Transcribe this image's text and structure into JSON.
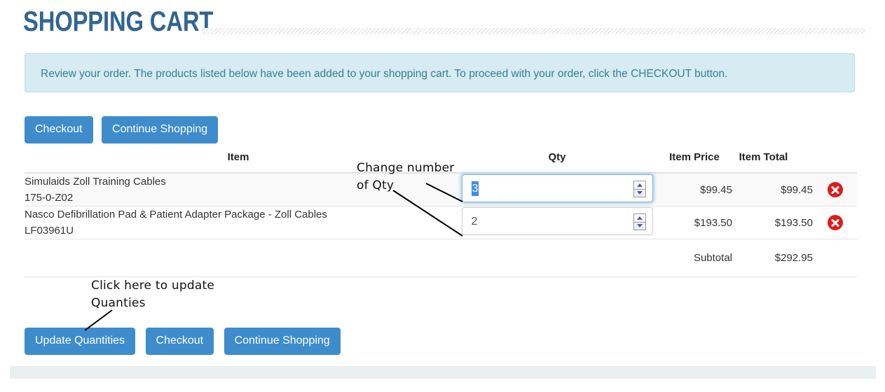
{
  "page": {
    "title": "SHOPPING CART"
  },
  "banner": {
    "message": "Review your order. The products listed below have been added to your shopping cart. To proceed with your order, click the CHECKOUT button."
  },
  "top_buttons": [
    {
      "label": "Checkout"
    },
    {
      "label": "Continue Shopping"
    }
  ],
  "table": {
    "headers": {
      "item": "Item",
      "qty": "Qty",
      "item_price": "Item Price",
      "item_total": "Item Total"
    },
    "rows": [
      {
        "name": "Simulaids Zoll Training Cables",
        "sku": "175-0-Z02",
        "qty": "3",
        "qty_focused": true,
        "qty_selected": true,
        "item_price": "$99.45",
        "item_total": "$99.45",
        "remove_icon": "remove-circle-icon"
      },
      {
        "name": "Nasco Defibrillation Pad & Patient Adapter Package - Zoll Cables",
        "sku": "LF03961U",
        "qty": "2",
        "qty_focused": false,
        "qty_selected": false,
        "item_price": "$193.50",
        "item_total": "$193.50",
        "remove_icon": "remove-circle-icon"
      }
    ],
    "subtotal": {
      "label": "Subtotal",
      "value": "$292.95"
    }
  },
  "bottom_buttons": [
    {
      "label": "Update Quantities"
    },
    {
      "label": "Checkout"
    },
    {
      "label": "Continue Shopping"
    }
  ],
  "annotations": {
    "qty": "Change number\nof Qty",
    "update": "Click here to update\nQuanties"
  },
  "colors": {
    "title_blue": "#2f6593",
    "button_blue": "#3e8ccc",
    "banner_bg": "#d6ebf2",
    "banner_border": "#bcdfe9",
    "banner_text": "#3a7d95",
    "remove_red": "#e01b1b",
    "row_stripe": "#f9f9f9",
    "footer_band": "#e9eeef",
    "selection_blue": "#3a8eea"
  }
}
